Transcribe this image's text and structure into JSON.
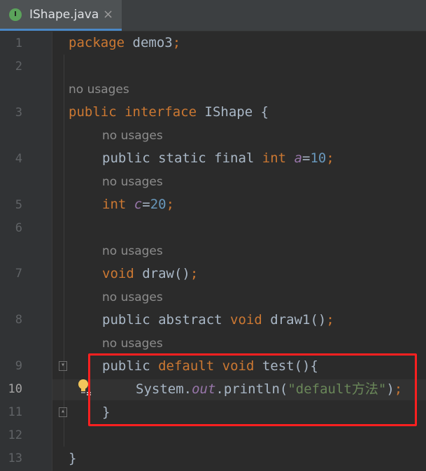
{
  "tab": {
    "icon_letter": "I",
    "icon": "interface-icon",
    "title": "IShape.java",
    "close": "×"
  },
  "gutter": {
    "lines": [
      "1",
      "2",
      "3",
      "4",
      "5",
      "6",
      "7",
      "8",
      "9",
      "10",
      "11",
      "12",
      "13"
    ]
  },
  "hints": {
    "interface_usages": "no usages",
    "a_usages": "no usages",
    "c_usages": "no usages",
    "draw_usages": "no usages",
    "draw1_usages": "no usages",
    "test_usages": "no usages"
  },
  "code": {
    "l1": {
      "kw": "package",
      "name": " demo3",
      "semi": ";"
    },
    "l3": {
      "kw1": "public",
      "kw2": "interface",
      "name": "IShape",
      "brace": " {"
    },
    "l4": {
      "mods": "public static final",
      "type": "int",
      "field": "a",
      "eq": "=",
      "val": "10",
      "semi": ";"
    },
    "l5": {
      "type": "int",
      "field": "c",
      "eq": "=",
      "val": "20",
      "semi": ";"
    },
    "l7": {
      "type": "void",
      "name": " draw",
      "parens": "()",
      "semi": ";"
    },
    "l8": {
      "mods": "public abstract",
      "type": "void",
      "name": " draw1",
      "parens": "()",
      "semi": ";"
    },
    "l9": {
      "mod": "public",
      "kw": "default",
      "type": "void",
      "name": " test",
      "rest": "(){"
    },
    "l10": {
      "cls": "System.",
      "field": "out",
      "call": ".println(",
      "str": "\"default方法\"",
      "close": ")",
      "semi": ";"
    },
    "l11": {
      "brace": "}"
    },
    "l13": {
      "brace": "}"
    }
  },
  "colors": {
    "background": "#2b2b2b",
    "keyword": "#cc7832",
    "number": "#6897bb",
    "field": "#9876aa",
    "string": "#6a8759",
    "annotation_box": "#ff2020"
  }
}
